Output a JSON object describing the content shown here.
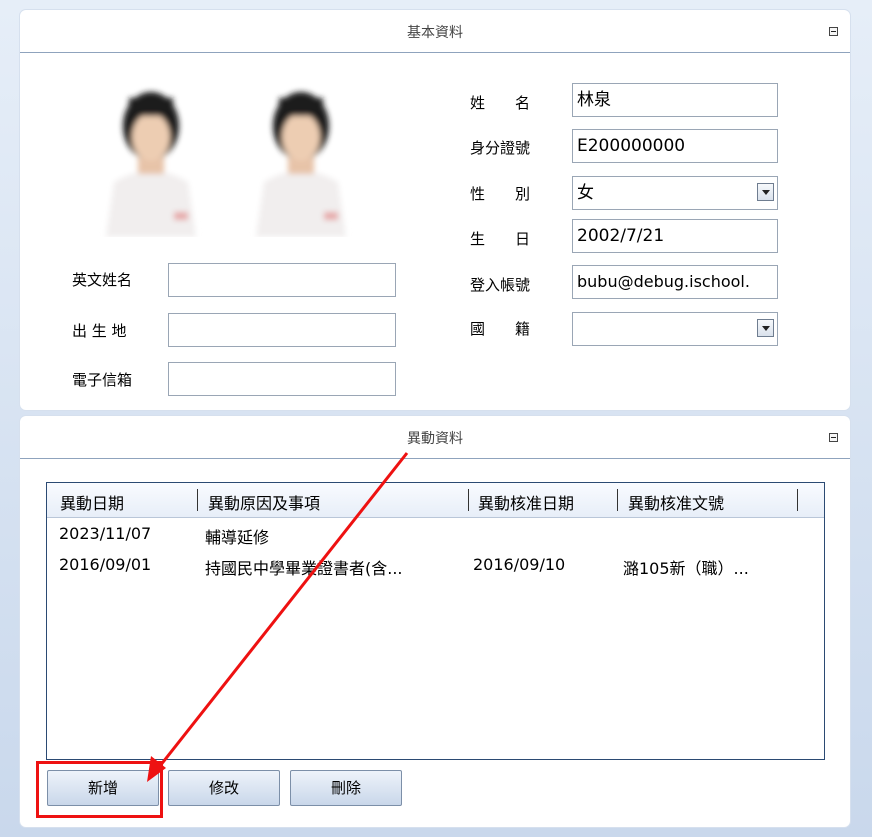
{
  "basic_panel": {
    "title": "基本資料"
  },
  "photos": [
    "學生照片",
    "學生照片"
  ],
  "left_fields": [
    {
      "label": "英文姓名",
      "value": ""
    },
    {
      "label": "出 生 地",
      "value": ""
    },
    {
      "label": "電子信箱",
      "value": ""
    }
  ],
  "right_fields": {
    "name": {
      "label": "姓　　名",
      "value": "林泉"
    },
    "id": {
      "label": "身分證號",
      "value": "E200000000"
    },
    "gender": {
      "label": "性　　別",
      "value": "女"
    },
    "birthday": {
      "label": "生　　日",
      "value": "2002/7/21"
    },
    "login": {
      "label": "登入帳號",
      "value": "bubu@debug.ischool."
    },
    "nationality": {
      "label": "國　　籍",
      "value": ""
    }
  },
  "change_panel": {
    "title": "異動資料",
    "columns": [
      "異動日期",
      "異動原因及事項",
      "異動核准日期",
      "異動核准文號"
    ],
    "rows": [
      [
        "2023/11/07",
        "輔導延修",
        "",
        ""
      ],
      [
        "2016/09/01",
        "持國民中學畢業證書者(含...",
        "2016/09/10",
        "潞105新（職）..."
      ]
    ]
  },
  "buttons": {
    "add": "新增",
    "edit": "修改",
    "delete": "刪除"
  },
  "colors": {
    "annotation": "#ee1111",
    "list_border": "#2b4a73"
  }
}
